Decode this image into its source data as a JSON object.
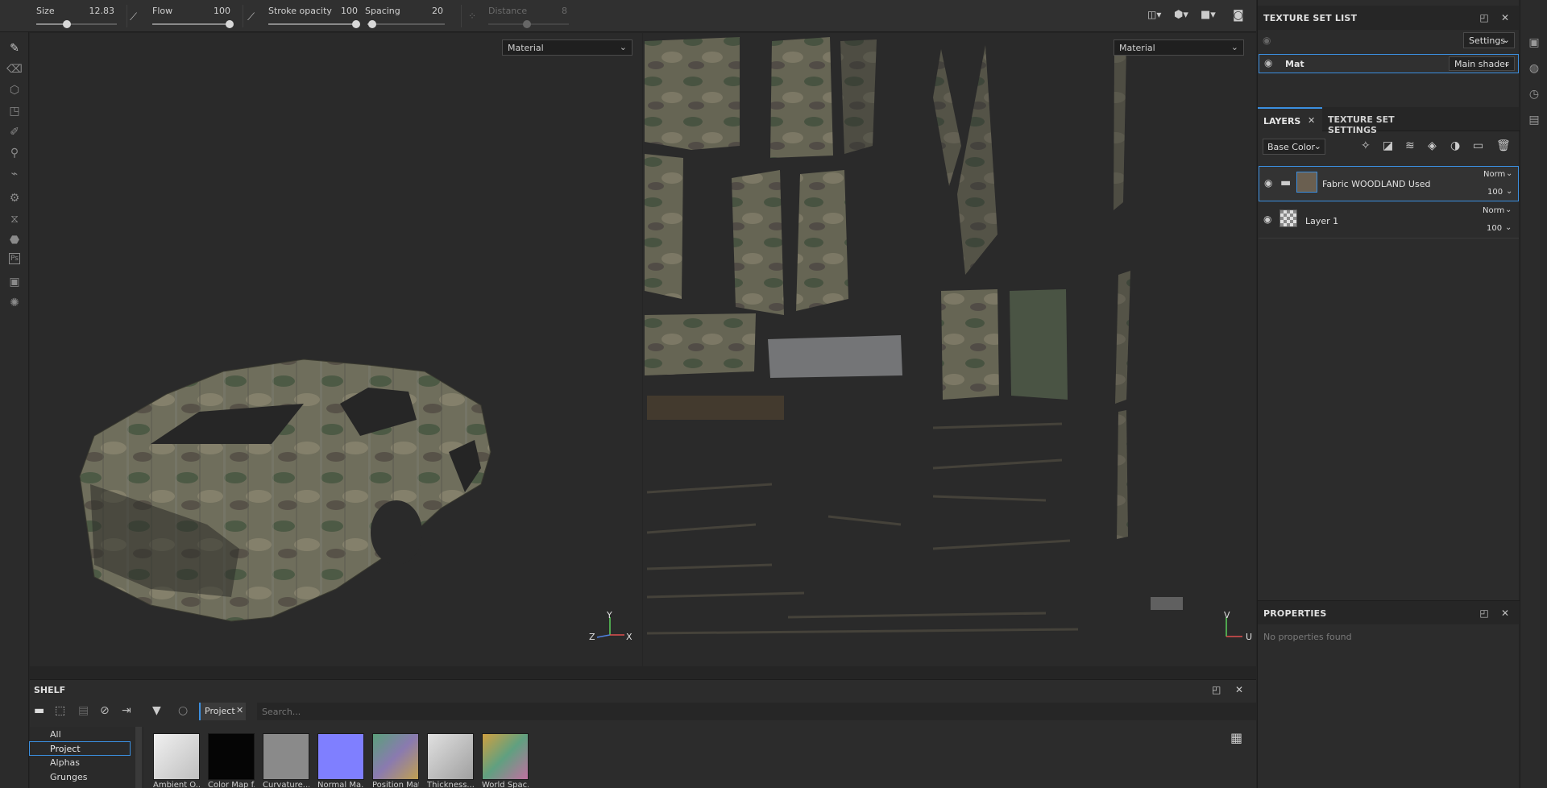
{
  "toolbar": {
    "size": {
      "label": "Size",
      "value": "12.83",
      "level": 0.38
    },
    "flow": {
      "label": "Flow",
      "value": "100",
      "level": 1.0
    },
    "stroke_opacity": {
      "label": "Stroke opacity",
      "value": "100",
      "level": 1.0
    },
    "spacing": {
      "label": "Spacing",
      "value": "20",
      "level": 0.05
    },
    "distance": {
      "label": "Distance",
      "value": "8",
      "level": 0.55
    }
  },
  "viewport_3d": {
    "channel_dropdown": "Material",
    "axis": {
      "y": "Y",
      "z": "Z",
      "x": "X"
    }
  },
  "viewport_2d": {
    "channel_dropdown": "Material",
    "axis": {
      "v": "V",
      "u": "U"
    }
  },
  "texture_set_list": {
    "title": "TEXTURE SET LIST",
    "settings_label": "Settings",
    "item": {
      "name": "Mat",
      "shader": "Main shader"
    }
  },
  "layers_panel": {
    "tab_layers": "LAYERS",
    "tab_texture_set_settings": "TEXTURE SET SETTINGS",
    "channel_dropdown": "Base Color",
    "layers": [
      {
        "name": "Fabric WOODLAND Used",
        "blend": "Norm",
        "opacity": "100",
        "type": "folder",
        "selected": true
      },
      {
        "name": "Layer 1",
        "blend": "Norm",
        "opacity": "100",
        "type": "layer",
        "selected": false
      }
    ]
  },
  "properties": {
    "title": "PROPERTIES",
    "empty_text": "No properties found"
  },
  "shelf": {
    "title": "SHELF",
    "filter_chip": "Project",
    "search_placeholder": "Search...",
    "categories": [
      "All",
      "Project",
      "Alphas",
      "Grunges"
    ],
    "selected_category": "Project",
    "items": [
      {
        "label": "Ambient O...",
        "color": "#dcdcdc"
      },
      {
        "label": "Color Map f...",
        "color": "#050505"
      },
      {
        "label": "Curvature...",
        "color": "#8a8a8a"
      },
      {
        "label": "Normal Ma...",
        "color": "#7f7fff"
      },
      {
        "label": "Position Mat...",
        "color": "#7a8a9a"
      },
      {
        "label": "Thickness...",
        "color": "#d0d0d0"
      },
      {
        "label": "World Spac...",
        "color": "#a09060"
      }
    ]
  },
  "colors": {
    "accent": "#3b8fe0",
    "panel": "#2c2c2c",
    "viewport": "#2a2a2a"
  }
}
